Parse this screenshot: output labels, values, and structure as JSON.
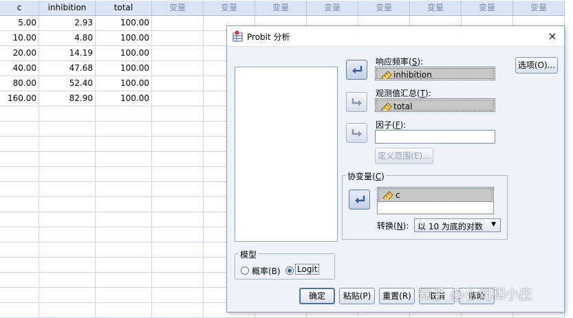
{
  "spreadsheet": {
    "headers": [
      "c",
      "inhibition",
      "total",
      "变量",
      "变量",
      "变量",
      "变量",
      "变量",
      "变量",
      "变量",
      "变量"
    ],
    "rows": [
      [
        "5.00",
        "2.93",
        "100.00"
      ],
      [
        "10.00",
        "4.80",
        "100.00"
      ],
      [
        "20.00",
        "14.19",
        "100.00"
      ],
      [
        "40.00",
        "47.68",
        "100.00"
      ],
      [
        "80.00",
        "52.40",
        "100.00"
      ],
      [
        "160.00",
        "82.90",
        "100.00"
      ]
    ]
  },
  "dialog": {
    "title": "Probit 分析",
    "close": "×",
    "response_freq": {
      "label": "响应频率(",
      "key": "S",
      "tail": "):",
      "value": "inhibition"
    },
    "observed_total": {
      "label": "观测值汇总(",
      "key": "T",
      "tail": "):",
      "value": "total"
    },
    "factor": {
      "label": "因子(",
      "key": "F",
      "tail": "):",
      "value": ""
    },
    "define_range_button": "定义范围(E)...",
    "options_button": "选项(O)...",
    "covariates": {
      "label": "协变量(",
      "key": "C",
      "tail": ")",
      "items": [
        "c"
      ]
    },
    "transform": {
      "label": "转换(",
      "key": "N",
      "tail": "):",
      "selected": "以 10 为底的对数"
    },
    "model": {
      "label": "模型",
      "options": [
        {
          "label": "概率(B)",
          "selected": false
        },
        {
          "label": "Logit",
          "selected": true
        }
      ]
    },
    "buttons": {
      "ok": "确定",
      "paste": "粘贴(P)",
      "reset": "重置(R)",
      "cancel": "取消",
      "help": "帮助"
    }
  },
  "watermark": "知乎 @小刘和小庄",
  "colors": {
    "header_bg": "#d9e4f4",
    "dialog_bg": "#eef3fa",
    "accent": "#4e6fa8"
  }
}
